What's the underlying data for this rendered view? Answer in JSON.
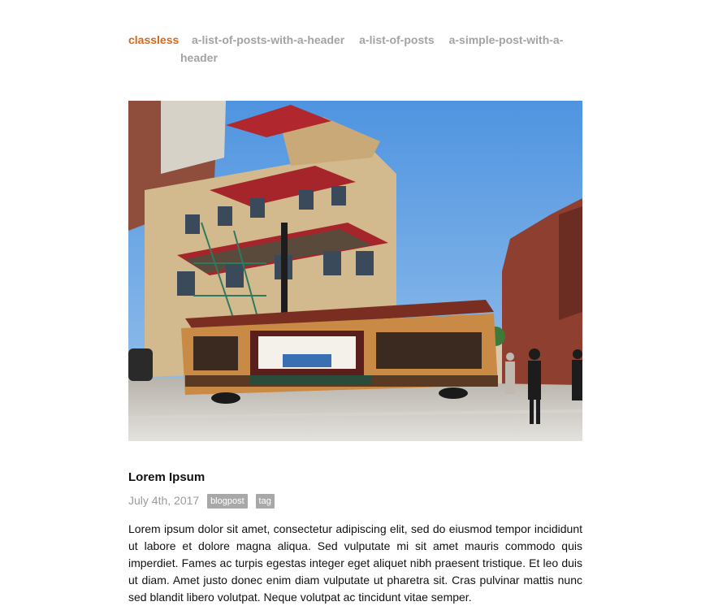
{
  "nav": {
    "brand": "classless",
    "links": [
      "a-list-of-posts-with-a-header",
      "a-list-of-posts",
      "a-simple-post-with-a-header"
    ]
  },
  "hero": {
    "icon": "cable-car-photo"
  },
  "post": {
    "title": "Lorem Ipsum",
    "date": "July 4th, 2017",
    "tags": [
      "blogpost",
      "tag"
    ],
    "excerpt": "Lorem ipsum dolor sit amet, consectetur adipiscing elit, sed do eiusmod tempor incididunt ut labore et dolore magna aliqua. Sed vulputate mi sit amet mauris commodo quis imperdiet. Fames ac turpis egestas integer eget aliquet nibh praesent tristique. Et leo duis ut diam. Amet justo donec enim diam vulputate ut pharetra sit. Cras pulvinar mattis nunc sed blandit libero volutpat. Neque volutpat ac tincidunt vitae semper."
  },
  "colors": {
    "brand": "#d2691e",
    "nav_link": "#a3a3a3",
    "meta": "#9b9b9b",
    "tag_bg": "#a8a8a8"
  }
}
